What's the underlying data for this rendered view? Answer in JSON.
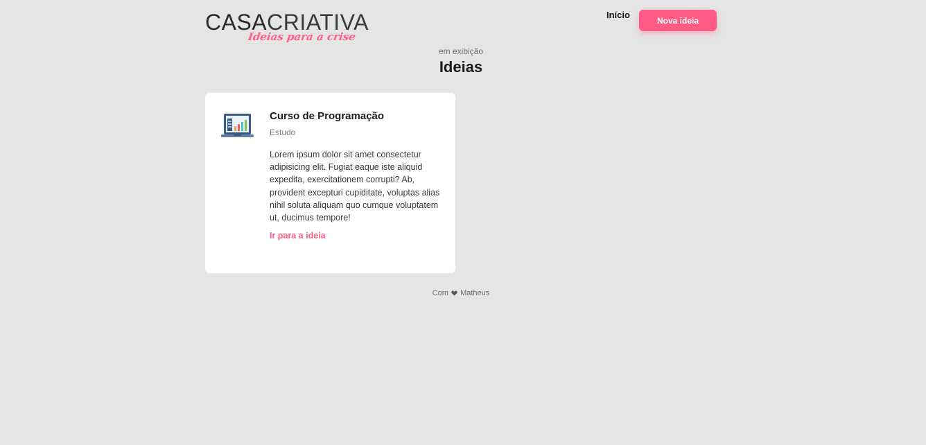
{
  "brand": {
    "name_bold": "CASA",
    "name_light": "CRIATIVA",
    "tagline": "Ideias para a crise",
    "accent_color": "#ff5b85"
  },
  "nav": {
    "home_label": "Início",
    "new_idea_label": "Nova ideia"
  },
  "header": {
    "subtitle": "em exibição",
    "title": "Ideias"
  },
  "ideas": [
    {
      "icon": "laptop-chart-icon",
      "title": "Curso de Programação",
      "category": "Estudo",
      "description": "Lorem ipsum dolor sit amet consectetur adipisicing elit. Fugiat eaque iste aliquid expedita, exercitationem corrupti? Ab, provident excepturi cupiditate, voluptas alias nihil soluta aliquam quo cumque voluptatem ut, ducimus tempore!",
      "link_label": "Ir para a ideia"
    }
  ],
  "footer": {
    "prefix": "Com",
    "author": "Matheus"
  }
}
